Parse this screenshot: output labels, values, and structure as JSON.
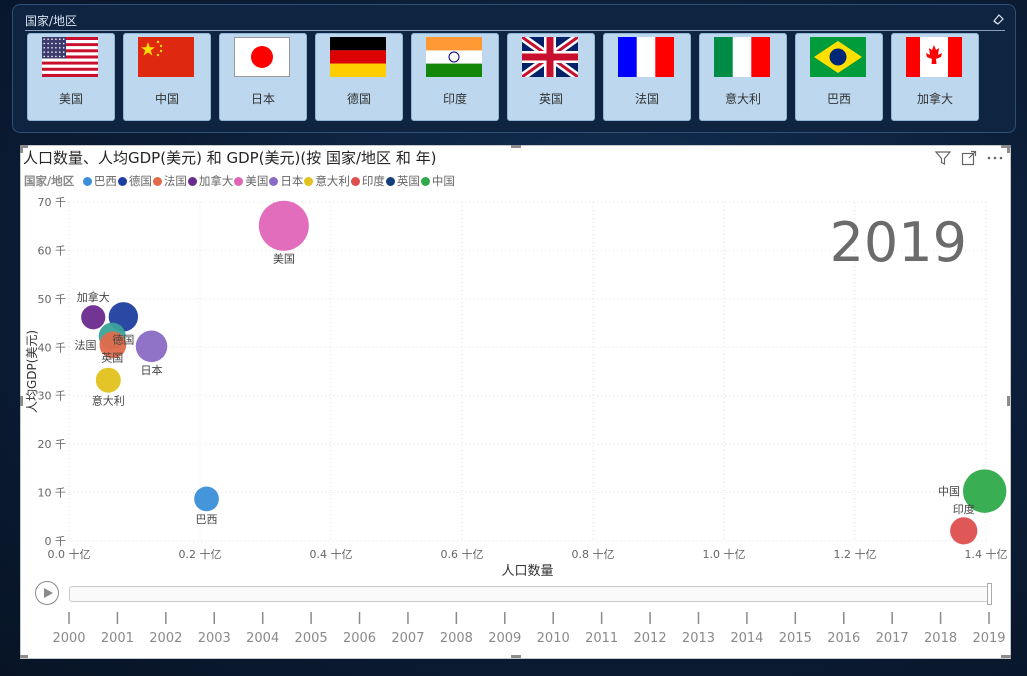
{
  "slicer": {
    "title": "国家/地区",
    "items": [
      {
        "label": "美国",
        "flag": "us-flag"
      },
      {
        "label": "中国",
        "flag": "cn-flag"
      },
      {
        "label": "日本",
        "flag": "jp-flag"
      },
      {
        "label": "德国",
        "flag": "de-flag"
      },
      {
        "label": "印度",
        "flag": "in-flag"
      },
      {
        "label": "英国",
        "flag": "gb-flag"
      },
      {
        "label": "法国",
        "flag": "fr-flag"
      },
      {
        "label": "意大利",
        "flag": "it-flag"
      },
      {
        "label": "巴西",
        "flag": "br-flag"
      },
      {
        "label": "加拿大",
        "flag": "ca-flag"
      }
    ]
  },
  "chart": {
    "title": "人口数量、人均GDP(美元) 和 GDP(美元)(按 国家/地区 和 年)",
    "legend_title": "国家/地区",
    "icons": [
      "filter-icon",
      "focus-mode-icon",
      "more-options-icon"
    ]
  },
  "chart_data": {
    "type": "scatter",
    "subtype": "bubble",
    "xlabel": "人口数量",
    "ylabel": "人均GDP(美元)",
    "size_field": "GDP(美元)",
    "xlim": [
      0,
      1.4
    ],
    "ylim": [
      0,
      70
    ],
    "x_ticks": [
      "0.0 十亿",
      "0.2 十亿",
      "0.4 十亿",
      "0.6 十亿",
      "0.8 十亿",
      "1.0 十亿",
      "1.2 十亿",
      "1.4 十亿"
    ],
    "y_ticks": [
      "0 千",
      "10 千",
      "20 千",
      "30 千",
      "40 千",
      "50 千",
      "60 千",
      "70 千"
    ],
    "x_tick_values": [
      0,
      0.2,
      0.4,
      0.6,
      0.8,
      1.0,
      1.2,
      1.4
    ],
    "y_tick_values": [
      0,
      10,
      20,
      30,
      40,
      50,
      60,
      70
    ],
    "grid": true,
    "legend_position": "top-left",
    "play_axis_label": "2019",
    "series": [
      {
        "name": "巴西",
        "color": "#3a8fd8",
        "x": 0.21,
        "y": 8.7,
        "gdp": 1.9,
        "label_pos": "below"
      },
      {
        "name": "德国",
        "color": "#1f3fa0",
        "x": 0.083,
        "y": 46.3,
        "gdp": 3.9,
        "label_pos": "below"
      },
      {
        "name": "法国",
        "color": "#e06a4a",
        "x": 0.067,
        "y": 40.5,
        "gdp": 2.7,
        "label_pos": "left"
      },
      {
        "name": "加拿大",
        "color": "#6b2a8e",
        "x": 0.037,
        "y": 46.2,
        "gdp": 1.7,
        "label_pos": "above"
      },
      {
        "name": "美国",
        "color": "#e065b8",
        "x": 0.328,
        "y": 65.1,
        "gdp": 21.4,
        "label_pos": "below"
      },
      {
        "name": "日本",
        "color": "#8a6bc4",
        "x": 0.126,
        "y": 40.2,
        "gdp": 5.1,
        "label_pos": "below"
      },
      {
        "name": "意大利",
        "color": "#e3c21c",
        "x": 0.06,
        "y": 33.2,
        "gdp": 2.0,
        "label_pos": "below"
      },
      {
        "name": "印度",
        "color": "#de4e4e",
        "x": 1.366,
        "y": 2.1,
        "gdp": 2.9,
        "label_pos": "above"
      },
      {
        "name": "英国",
        "color": "#123e7a",
        "x": 0.066,
        "y": 42.3,
        "gdp": 2.8,
        "label_pos": "below"
      },
      {
        "name": "中国",
        "color": "#2eaa4a",
        "x": 1.398,
        "y": 10.3,
        "gdp": 14.3,
        "label_pos": "left"
      }
    ],
    "circle_fill_colors": {
      "英国": "#3aa39a"
    }
  },
  "timeline": {
    "years": [
      "2000",
      "2001",
      "2002",
      "2003",
      "2004",
      "2005",
      "2006",
      "2007",
      "2008",
      "2009",
      "2010",
      "2011",
      "2012",
      "2013",
      "2014",
      "2015",
      "2016",
      "2017",
      "2018",
      "2019"
    ],
    "current": "2019"
  }
}
